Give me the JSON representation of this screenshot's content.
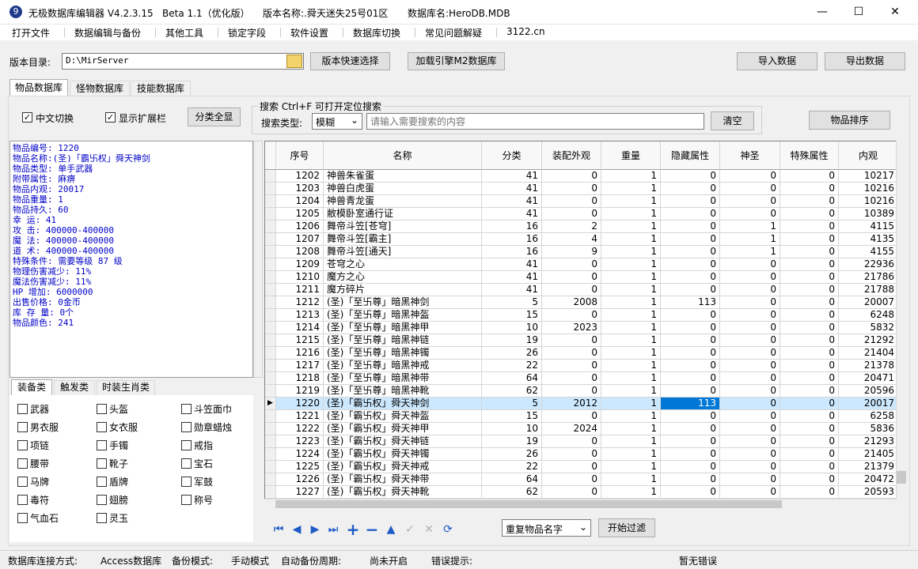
{
  "window": {
    "title": "无极数据库编辑器 V4.2.3.15",
    "beta": "Beta 1.1（优化版）",
    "version_label": "版本名称:.舜天迷失25号01区",
    "db_label": "数据库名:HeroDB.MDB"
  },
  "menu": [
    "打开文件",
    "数据编辑与备份",
    "其他工具",
    "锁定字段",
    "软件设置",
    "数据库切换",
    "常见问题解疑",
    "3122.cn"
  ],
  "toolbar": {
    "dir_label": "版本目录:",
    "dir_value": "D:\\MirServer",
    "quick_select": "版本快速选择",
    "load_m2": "加载引擎M2数据库",
    "import": "导入数据",
    "export": "导出数据"
  },
  "tabs": [
    "物品数据库",
    "怪物数据库",
    "技能数据库"
  ],
  "options": {
    "cn_switch": "中文切换",
    "show_ext": "显示扩展栏",
    "show_all": "分类全显",
    "search_title": "搜索  Ctrl+F 可打开定位搜索",
    "search_type_label": "搜索类型:",
    "search_type_value": "模糊",
    "search_placeholder": "请输入需要搜索的内容",
    "clear": "清空",
    "sort": "物品排序"
  },
  "info_lines": [
    "物品编号: 1220",
    "物品名称:(圣)「霸卐权」舜天神剑",
    "物品类型: 单手武器",
    "附带属性: 麻痹",
    "物品内观: 20017",
    "物品重量: 1",
    "物品持久: 60",
    "幸    运: 41",
    "攻    击: 400000-400000",
    "魔    法: 400000-400000",
    "道    术: 400000-400000",
    "特殊条件: 需要等级 87 级",
    "物理伤害减少: 11%",
    "魔法伤害减少: 11%",
    "HP  增加: 6000000",
    "出售价格: 0金币",
    "库 存 量: 0个",
    "物品颜色: 241"
  ],
  "cat_tabs": [
    "装备类",
    "触发类",
    "时装生肖类"
  ],
  "categories": [
    "武器",
    "头盔",
    "斗笠面巾",
    "男衣服",
    "女衣服",
    "勋章蜡烛",
    "项链",
    "手镯",
    "戒指",
    "腰带",
    "靴子",
    "宝石",
    "马牌",
    "盾牌",
    "军鼓",
    "毒符",
    "翅膀",
    "称号",
    "气血石",
    "灵玉"
  ],
  "columns": [
    "序号",
    "名称",
    "分类",
    "装配外观",
    "重量",
    "隐藏属性",
    "神圣",
    "特殊属性",
    "内观"
  ],
  "rows": [
    [
      "1202",
      "神兽朱雀蛋",
      "41",
      "0",
      "1",
      "0",
      "0",
      "0",
      "10217"
    ],
    [
      "1203",
      "神兽白虎蛋",
      "41",
      "0",
      "1",
      "0",
      "0",
      "0",
      "10216"
    ],
    [
      "1204",
      "神兽青龙蛋",
      "41",
      "0",
      "1",
      "0",
      "0",
      "0",
      "10216"
    ],
    [
      "1205",
      "敝模卧室通行证",
      "41",
      "0",
      "1",
      "0",
      "0",
      "0",
      "10389"
    ],
    [
      "1206",
      "舞帝斗笠[苍穹]",
      "16",
      "2",
      "1",
      "0",
      "1",
      "0",
      "4115"
    ],
    [
      "1207",
      "舞帝斗笠[霸主]",
      "16",
      "4",
      "1",
      "0",
      "1",
      "0",
      "4135"
    ],
    [
      "1208",
      "舞帝斗笠[通天]",
      "16",
      "9",
      "1",
      "0",
      "1",
      "0",
      "4155"
    ],
    [
      "1209",
      "苍穹之心",
      "41",
      "0",
      "1",
      "0",
      "0",
      "0",
      "22936"
    ],
    [
      "1210",
      "魔方之心",
      "41",
      "0",
      "1",
      "0",
      "0",
      "0",
      "21786"
    ],
    [
      "1211",
      "魔方碎片",
      "41",
      "0",
      "1",
      "0",
      "0",
      "0",
      "21788"
    ],
    [
      "1212",
      "(圣)「至卐尊」暗黑神剑",
      "5",
      "2008",
      "1",
      "113",
      "0",
      "0",
      "20007"
    ],
    [
      "1213",
      "(圣)「至卐尊」暗黑神盔",
      "15",
      "0",
      "1",
      "0",
      "0",
      "0",
      "6248"
    ],
    [
      "1214",
      "(圣)「至卐尊」暗黑神甲",
      "10",
      "2023",
      "1",
      "0",
      "0",
      "0",
      "5832"
    ],
    [
      "1215",
      "(圣)「至卐尊」暗黑神链",
      "19",
      "0",
      "1",
      "0",
      "0",
      "0",
      "21292"
    ],
    [
      "1216",
      "(圣)「至卐尊」暗黑神镯",
      "26",
      "0",
      "1",
      "0",
      "0",
      "0",
      "21404"
    ],
    [
      "1217",
      "(圣)「至卐尊」暗黑神戒",
      "22",
      "0",
      "1",
      "0",
      "0",
      "0",
      "21378"
    ],
    [
      "1218",
      "(圣)「至卐尊」暗黑神带",
      "64",
      "0",
      "1",
      "0",
      "0",
      "0",
      "20471"
    ],
    [
      "1219",
      "(圣)「至卐尊」暗黑神靴",
      "62",
      "0",
      "1",
      "0",
      "0",
      "0",
      "20596"
    ],
    [
      "1220",
      "(圣)「霸卐权」舜天神剑",
      "5",
      "2012",
      "1",
      "113",
      "0",
      "0",
      "20017"
    ],
    [
      "1221",
      "(圣)「霸卐权」舜天神盔",
      "15",
      "0",
      "1",
      "0",
      "0",
      "0",
      "6258"
    ],
    [
      "1222",
      "(圣)「霸卐权」舜天神甲",
      "10",
      "2024",
      "1",
      "0",
      "0",
      "0",
      "5836"
    ],
    [
      "1223",
      "(圣)「霸卐权」舜天神链",
      "19",
      "0",
      "1",
      "0",
      "0",
      "0",
      "21293"
    ],
    [
      "1224",
      "(圣)「霸卐权」舜天神镯",
      "26",
      "0",
      "1",
      "0",
      "0",
      "0",
      "21405"
    ],
    [
      "1225",
      "(圣)「霸卐权」舜天神戒",
      "22",
      "0",
      "1",
      "0",
      "0",
      "0",
      "21379"
    ],
    [
      "1226",
      "(圣)「霸卐权」舜天神带",
      "64",
      "0",
      "1",
      "0",
      "0",
      "0",
      "20472"
    ],
    [
      "1227",
      "(圣)「霸卐权」舜天神靴",
      "62",
      "0",
      "1",
      "0",
      "0",
      "0",
      "20593"
    ]
  ],
  "selected_row": "1220",
  "filter": {
    "select_value": "重复物品名字",
    "start": "开始过滤"
  },
  "status": {
    "conn_label": "数据库连接方式:",
    "conn_value": "Access数据库",
    "backup_label": "备份模式:",
    "backup_value": "手动模式",
    "auto_label": "自动备份周期:",
    "auto_value": "尚未开启",
    "err_label": "错误提示:",
    "err_value": "暂无错误"
  }
}
